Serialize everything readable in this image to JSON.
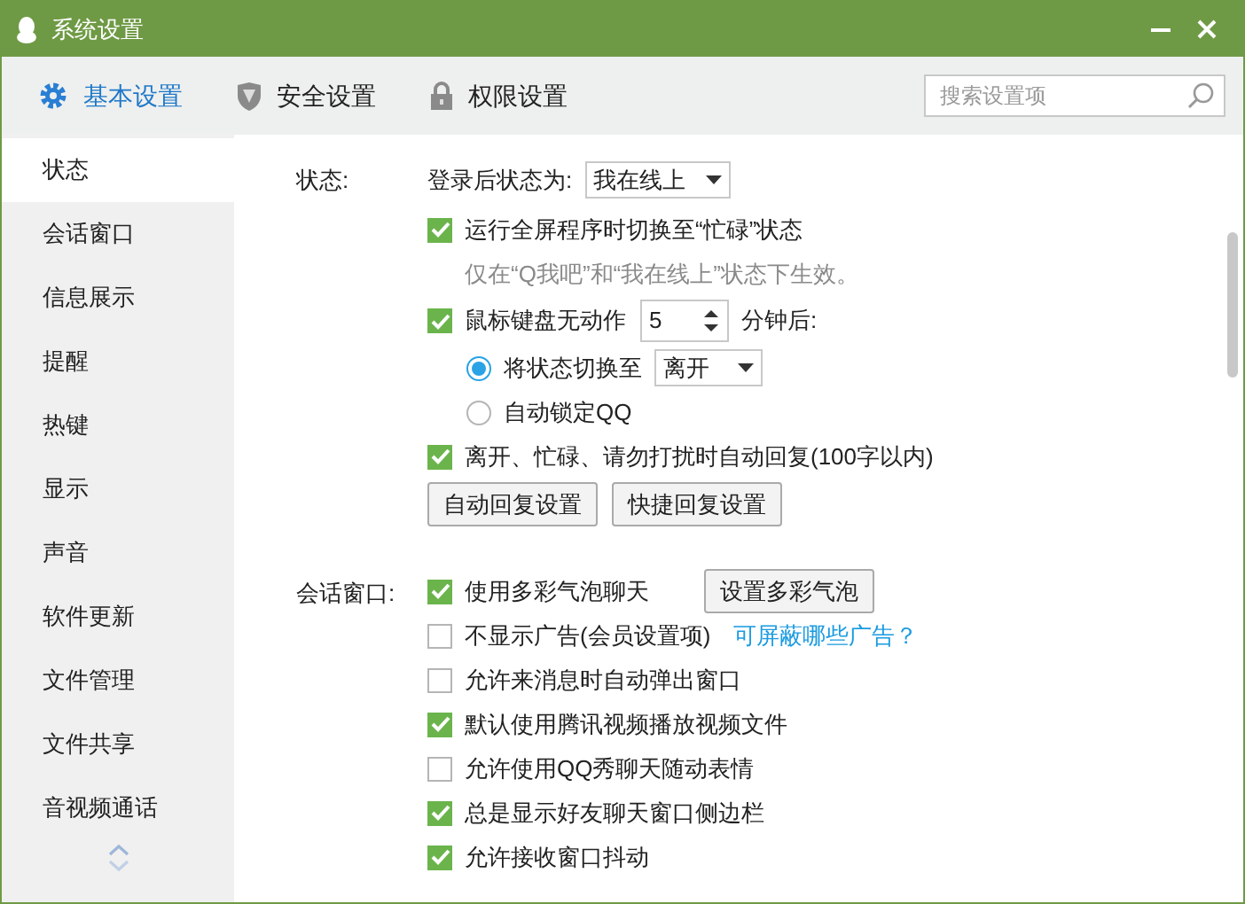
{
  "window": {
    "title": "系统设置"
  },
  "tabs": [
    {
      "label": "基本设置",
      "selected": true
    },
    {
      "label": "安全设置",
      "selected": false
    },
    {
      "label": "权限设置",
      "selected": false
    }
  ],
  "search": {
    "placeholder": "搜索设置项"
  },
  "sidebar": {
    "items": [
      {
        "label": "状态",
        "selected": true
      },
      {
        "label": "会话窗口",
        "selected": false
      },
      {
        "label": "信息展示",
        "selected": false
      },
      {
        "label": "提醒",
        "selected": false
      },
      {
        "label": "热键",
        "selected": false
      },
      {
        "label": "显示",
        "selected": false
      },
      {
        "label": "声音",
        "selected": false
      },
      {
        "label": "软件更新",
        "selected": false
      },
      {
        "label": "文件管理",
        "selected": false
      },
      {
        "label": "文件共享",
        "selected": false
      },
      {
        "label": "音视频通话",
        "selected": false
      }
    ]
  },
  "sections": [
    {
      "label": "状态:",
      "rows": [
        {
          "kind": "dropdown",
          "label": "登录后状态为:",
          "value": "我在线上"
        },
        {
          "kind": "checkbox",
          "label": "运行全屏程序时切换至“忙碌”状态",
          "checked": true
        },
        {
          "kind": "hint",
          "label": "仅在“Q我吧”和“我在线上”状态下生效。"
        },
        {
          "kind": "spinner",
          "label": "鼠标键盘无动作",
          "checked": true,
          "value": "5",
          "suffix": "分钟后:"
        },
        {
          "kind": "radio",
          "label": "将状态切换至",
          "selected": true,
          "value": "离开"
        },
        {
          "kind": "radio",
          "label": "自动锁定QQ",
          "selected": false
        },
        {
          "kind": "checkbox",
          "label": "离开、忙碌、请勿打扰时自动回复(100字以内)",
          "checked": true
        },
        {
          "kind": "buttons",
          "buttons": [
            "自动回复设置",
            "快捷回复设置"
          ]
        }
      ]
    },
    {
      "label": "会话窗口:",
      "rows": [
        {
          "kind": "checkbox",
          "label": "使用多彩气泡聊天",
          "checked": true,
          "button": "设置多彩气泡"
        },
        {
          "kind": "checkbox",
          "label": "不显示广告(会员设置项)",
          "checked": false,
          "link": "可屏蔽哪些广告？"
        },
        {
          "kind": "checkbox",
          "label": "允许来消息时自动弹出窗口",
          "checked": false
        },
        {
          "kind": "checkbox",
          "label": "默认使用腾讯视频播放视频文件",
          "checked": true
        },
        {
          "kind": "checkbox",
          "label": "允许使用QQ秀聊天随动表情",
          "checked": false
        },
        {
          "kind": "checkbox",
          "label": "总是显示好友聊天窗口侧边栏",
          "checked": true
        },
        {
          "kind": "checkbox",
          "label": "允许接收窗口抖动",
          "checked": true
        }
      ]
    }
  ]
}
